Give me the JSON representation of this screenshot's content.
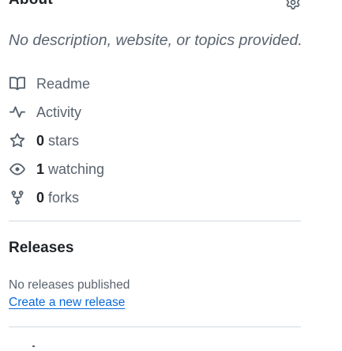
{
  "about": {
    "title": "About",
    "settings_icon": "gear-icon",
    "description": "No description, website, or topics provided."
  },
  "meta": [
    {
      "icon": "book-icon",
      "count": "",
      "label": "Readme"
    },
    {
      "icon": "pulse-icon",
      "count": "",
      "label": "Activity"
    },
    {
      "icon": "star-icon",
      "count": "0",
      "label": "stars"
    },
    {
      "icon": "eye-icon",
      "count": "1",
      "label": "watching"
    },
    {
      "icon": "fork-icon",
      "count": "0",
      "label": "forks"
    }
  ],
  "releases": {
    "title": "Releases",
    "empty_text": "No releases published",
    "create_link": "Create a new release"
  },
  "colors": {
    "text": "#1f2328",
    "muted": "#59636e",
    "link": "#0969da",
    "border": "#d1d9e0"
  }
}
